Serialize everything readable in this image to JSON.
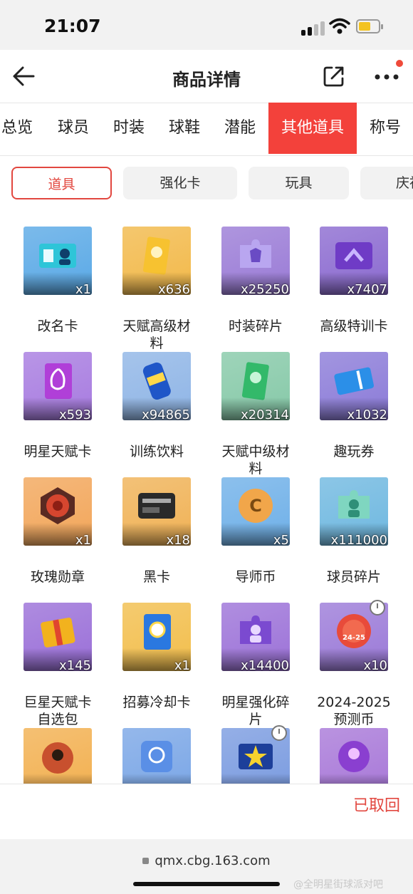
{
  "status_bar": {
    "time": "21:07"
  },
  "nav": {
    "title": "商品详情"
  },
  "tabs": [
    {
      "label": "总览"
    },
    {
      "label": "球员"
    },
    {
      "label": "时装"
    },
    {
      "label": "球鞋"
    },
    {
      "label": "潜能"
    },
    {
      "label": "其他道具",
      "active": true
    },
    {
      "label": "称号"
    }
  ],
  "chips": [
    {
      "label": "道具",
      "active": true
    },
    {
      "label": "强化卡"
    },
    {
      "label": "玩具"
    },
    {
      "label": "庆祝"
    }
  ],
  "items": [
    {
      "name": "改名卡",
      "qty": "x1",
      "color": "#5aa9e6",
      "icon": "id-card-icon"
    },
    {
      "name": "天赋高级材料",
      "qty": "x636",
      "color": "#f2b94a",
      "icon": "gold-pack-icon"
    },
    {
      "name": "时装碎片",
      "qty": "x25250",
      "color": "#9a7bd6",
      "icon": "puzzle-shirt-icon"
    },
    {
      "name": "高级特训卡",
      "qty": "x7407",
      "color": "#8b6ad0",
      "icon": "purple-card-icon"
    },
    {
      "name": "明星天赋卡",
      "qty": "x593",
      "color": "#a77be0",
      "icon": "star-card-icon"
    },
    {
      "name": "训练饮料",
      "qty": "x94865",
      "color": "#8fb5e6",
      "icon": "drink-can-icon"
    },
    {
      "name": "天赋中级材料",
      "qty": "x20314",
      "color": "#86c9a8",
      "icon": "green-pack-icon"
    },
    {
      "name": "趣玩券",
      "qty": "x1032",
      "color": "#8b7bd8",
      "icon": "ticket-icon"
    },
    {
      "name": "玫瑰勋章",
      "qty": "x1",
      "color": "#f2a65a",
      "icon": "rose-medal-icon"
    },
    {
      "name": "黑卡",
      "qty": "x18",
      "color": "#f0b256",
      "icon": "black-card-icon"
    },
    {
      "name": "导师币",
      "qty": "x5",
      "color": "#6fb0e8",
      "icon": "mentor-coin-icon"
    },
    {
      "name": "球员碎片",
      "qty": "x111000",
      "color": "#6fb8e0",
      "icon": "puzzle-player-icon"
    },
    {
      "name": "巨星天赋卡自选包",
      "qty": "x145",
      "color": "#9a6fd8",
      "icon": "gift-pack-icon"
    },
    {
      "name": "招募冷却卡",
      "qty": "x1",
      "color": "#f2be4c",
      "icon": "cooldown-card-icon"
    },
    {
      "name": "明星强化碎片",
      "qty": "x14400",
      "color": "#9c72d8",
      "icon": "puzzle-star-icon"
    },
    {
      "name": "2024-2025预测币",
      "qty": "x10",
      "color": "#9b7ad8",
      "icon": "predict-coin-icon",
      "timer": true
    },
    {
      "name": "",
      "qty": "",
      "color": "#f2b050",
      "icon": "avatar-frame-icon"
    },
    {
      "name": "",
      "qty": "",
      "color": "#7aa6e6",
      "icon": "avatar-blue-icon"
    },
    {
      "name": "",
      "qty": "",
      "color": "#7a9be0",
      "icon": "star-badge-icon",
      "timer": true
    },
    {
      "name": "",
      "qty": "",
      "color": "#a878d8",
      "icon": "avatar-purple-icon"
    }
  ],
  "bottom": {
    "withdrawn_label": "已取回"
  },
  "browser": {
    "url": "qmx.cbg.163.com"
  },
  "watermark": "@全明星街球派对吧"
}
